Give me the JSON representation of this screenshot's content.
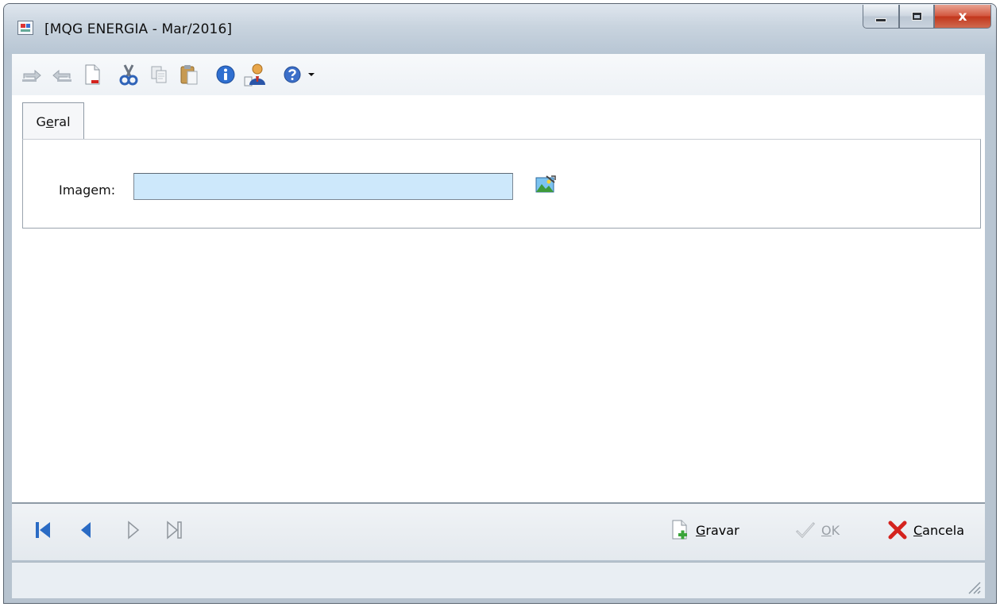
{
  "window": {
    "title": "[MQG ENERGIA - Mar/2016]",
    "close_label": "x"
  },
  "toolbar": {
    "icons": [
      "undo-icon",
      "redo-icon",
      "new-document-icon",
      "cut-icon",
      "copy-icon",
      "paste-icon",
      "info-icon",
      "user-icon",
      "help-icon",
      "dropdown-arrow-icon"
    ]
  },
  "tabs": [
    {
      "label_pre": "G",
      "label_underlined": "e",
      "label_post": "ral"
    }
  ],
  "form": {
    "image_label": "Imagem:",
    "image_value": ""
  },
  "navigation": [
    "first-record-icon",
    "previous-record-icon",
    "next-record-icon",
    "last-record-icon"
  ],
  "actions": {
    "save": {
      "underlined": "G",
      "rest": "ravar"
    },
    "ok": {
      "underlined": "O",
      "rest": "K"
    },
    "cancel": {
      "underlined": "C",
      "rest": "ancela"
    }
  },
  "colors": {
    "input_bg": "#cde8fb",
    "nav_active": "#2a6bc4",
    "cancel_red": "#d4231e"
  }
}
